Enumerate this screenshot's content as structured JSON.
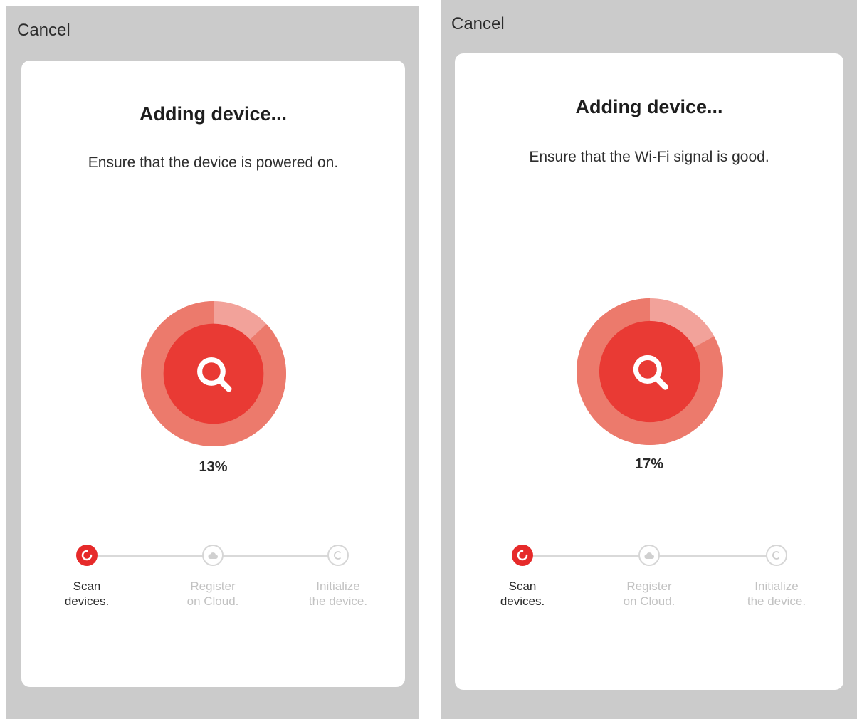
{
  "screens": [
    {
      "cancel_label": "Cancel",
      "title": "Adding device...",
      "subtitle": "Ensure that the device is powered on.",
      "progress_percent": 13,
      "progress_label": "13%",
      "steps": [
        {
          "line1": "Scan",
          "line2": "devices.",
          "state": "active",
          "icon": "spinner-icon"
        },
        {
          "line1": "Register",
          "line2": "on Cloud.",
          "state": "pending",
          "icon": "cloud-icon"
        },
        {
          "line1": "Initialize",
          "line2": "the device.",
          "state": "pending",
          "icon": "refresh-icon"
        }
      ]
    },
    {
      "cancel_label": "Cancel",
      "title": "Adding device...",
      "subtitle": "Ensure that the Wi-Fi signal is good.",
      "progress_percent": 17,
      "progress_label": "17%",
      "steps": [
        {
          "line1": "Scan",
          "line2": "devices.",
          "state": "active",
          "icon": "spinner-icon"
        },
        {
          "line1": "Register",
          "line2": "on Cloud.",
          "state": "pending",
          "icon": "cloud-icon"
        },
        {
          "line1": "Initialize",
          "line2": "the device.",
          "state": "pending",
          "icon": "refresh-icon"
        }
      ]
    }
  ],
  "colors": {
    "accent": "#e62a2a",
    "ring_outer": "#f2a29a",
    "ring_progress": "#ec7a6c",
    "ring_inner": "#e93a34",
    "background": "#cbcbcb"
  }
}
